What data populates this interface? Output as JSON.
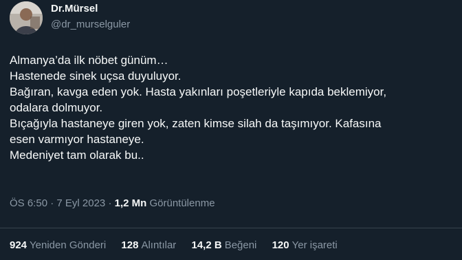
{
  "author": {
    "name": "Dr.Mürsel",
    "handle": "@dr_murselguler"
  },
  "tweet": {
    "lines": [
      "Almanya’da ilk nöbet günüm…",
      "Hastenede sinek uçsa duyuluyor.",
      "Bağıran, kavga eden yok. Hasta yakınları poşetleriyle kapıda beklemiyor,",
      "odalara dolmuyor.",
      "Bıçağıyla hastaneye giren yok, zaten kimse silah da taşımıyor. Kafasına",
      "esen varmıyor hastaneye.",
      "Medeniyet tam olarak bu.."
    ]
  },
  "meta": {
    "time": "ÖS 6:50",
    "sep1": "·",
    "date": "7 Eyl 2023",
    "sep2": "·",
    "views_count": "1,2 Mn",
    "views_label": "Görüntülenme"
  },
  "stats": [
    {
      "count": "924",
      "label": "Yeniden Gönderi"
    },
    {
      "count": "128",
      "label": "Alıntılar"
    },
    {
      "count": "14,2 B",
      "label": "Beğeni"
    },
    {
      "count": "120",
      "label": "Yer işareti"
    }
  ],
  "colors": {
    "background": "#15202b",
    "text": "#f7f9f9",
    "secondary": "#8b98a5",
    "divider": "#38444d"
  }
}
